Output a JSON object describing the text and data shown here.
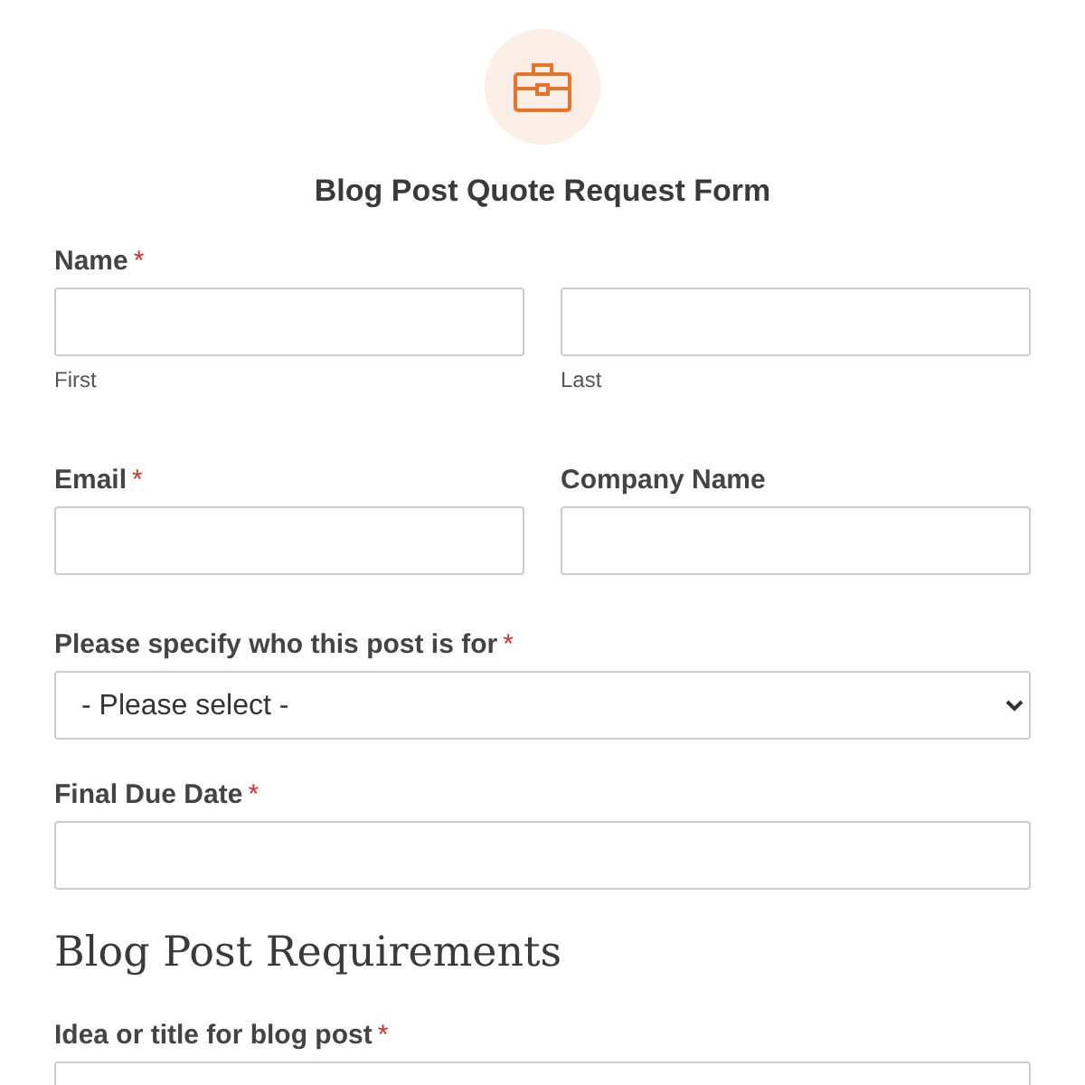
{
  "header": {
    "title": "Blog Post Quote Request Form"
  },
  "required_mark": "*",
  "rows": [
    {
      "kind": "name",
      "label": "Name",
      "required": true,
      "parts": [
        {
          "sublabel": "First"
        },
        {
          "sublabel": "Last"
        }
      ]
    },
    {
      "kind": "columns",
      "fields": [
        {
          "label": "Email",
          "required": true
        },
        {
          "label": "Company Name",
          "required": false
        }
      ]
    },
    {
      "kind": "select",
      "label": "Please specify who this post is for",
      "required": true,
      "value": "- Please select -"
    },
    {
      "kind": "text",
      "label": "Final Due Date",
      "required": true
    },
    {
      "kind": "section",
      "title": "Blog Post Requirements"
    },
    {
      "kind": "text",
      "label": "Idea or title for blog post",
      "required": true
    }
  ]
}
